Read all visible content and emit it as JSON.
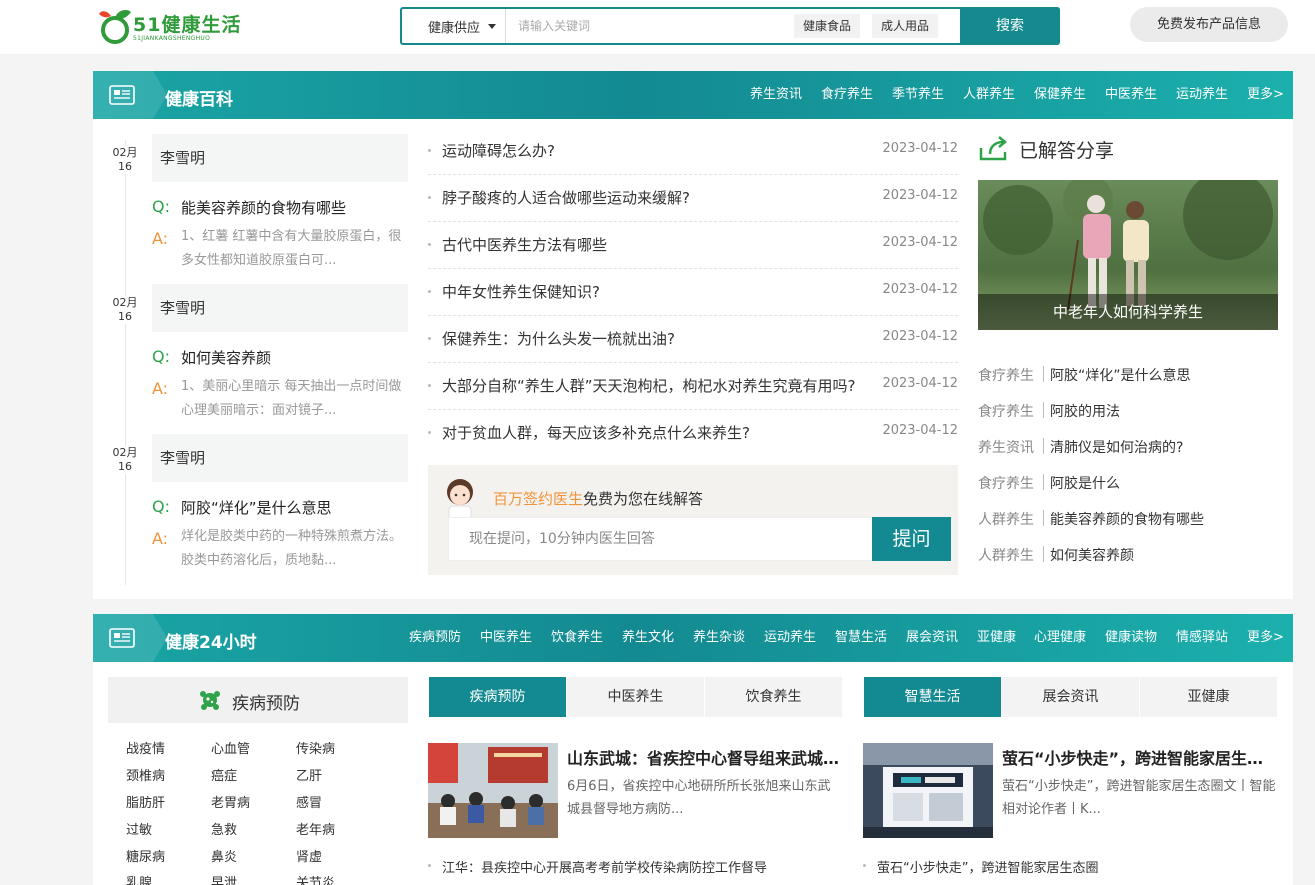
{
  "header": {
    "logo_text": "51健康生活",
    "logo_sub": "51JIANKANGSHENGHUO",
    "search_category": "健康供应",
    "search_placeholder": "请输入关键词",
    "hot_tags": [
      "健康食品",
      "成人用品"
    ],
    "search_button": "搜索",
    "publish_button": "免费发布产品信息"
  },
  "section1": {
    "title": "健康百科",
    "nav": [
      "养生资讯",
      "食疗养生",
      "季节养生",
      "人群养生",
      "保健养生",
      "中医养生",
      "运动养生",
      "更多>"
    ],
    "qa": [
      {
        "month": "02月",
        "day": "16",
        "asker": "李雪明",
        "q_mark": "Q:",
        "question": "能美容养颜的食物有哪些",
        "a_mark": "A:",
        "answer": "1、红薯 红薯中含有大量胶原蛋白，很多女性都知道胶原蛋白可..."
      },
      {
        "month": "02月",
        "day": "16",
        "asker": "李雪明",
        "q_mark": "Q:",
        "question": "如何美容养颜",
        "a_mark": "A:",
        "answer": "1、美丽心里暗示 每天抽出一点时间做心理美丽暗示：面对镜子..."
      },
      {
        "month": "02月",
        "day": "16",
        "asker": "李雪明",
        "q_mark": "Q:",
        "question": "阿胶“烊化”是什么意思",
        "a_mark": "A:",
        "answer": "烊化是胶类中药的一种特殊煎煮方法。 胶类中药溶化后，质地黏..."
      }
    ],
    "list": [
      {
        "title": "运动障碍怎么办?",
        "date": "2023-04-12"
      },
      {
        "title": "脖子酸疼的人适合做哪些运动来缓解?",
        "date": "2023-04-12"
      },
      {
        "title": "古代中医养生方法有哪些",
        "date": "2023-04-12"
      },
      {
        "title": "中年女性养生保健知识?",
        "date": "2023-04-12"
      },
      {
        "title": "保健养生：为什么头发一梳就出油?",
        "date": "2023-04-12"
      },
      {
        "title": "大部分自称“养生人群”天天泡枸杞，枸杞水对养生究竟有用吗?",
        "date": "2023-04-12"
      },
      {
        "title": "对于贫血人群，每天应该多补充点什么来养生?",
        "date": "2023-04-12"
      }
    ],
    "ask": {
      "highlight": "百万签约医生",
      "rest": "免费为您在线解答",
      "placeholder": "现在提问，10分钟内医生回答",
      "button": "提问"
    },
    "shared": {
      "title": "已解答分享",
      "photo_caption": "中老年人如何科学养生",
      "items": [
        {
          "cat": "食疗养生",
          "title": "阿胶“烊化”是什么意思"
        },
        {
          "cat": "食疗养生",
          "title": "阿胶的用法"
        },
        {
          "cat": "养生资讯",
          "title": "清肺仪是如何治病的?"
        },
        {
          "cat": "食疗养生",
          "title": "阿胶是什么"
        },
        {
          "cat": "人群养生",
          "title": "能美容养颜的食物有哪些"
        },
        {
          "cat": "人群养生",
          "title": "如何美容养颜"
        }
      ]
    }
  },
  "section2": {
    "title": "健康24小时",
    "nav": [
      "疾病预防",
      "中医养生",
      "饮食养生",
      "养生文化",
      "养生杂谈",
      "运动养生",
      "智慧生活",
      "展会资讯",
      "亚健康",
      "心理健康",
      "健康读物",
      "情感驿站",
      "更多>"
    ],
    "category_title": "疾病预防",
    "categories": [
      [
        "战疫情",
        "心血管",
        "传染病"
      ],
      [
        "颈椎病",
        "癌症",
        "乙肝"
      ],
      [
        "脂肪肝",
        "老胃病",
        "感冒"
      ],
      [
        "过敏",
        "急救",
        "老年病"
      ],
      [
        "糖尿病",
        "鼻炎",
        "肾虚"
      ],
      [
        "乳腺",
        "早泄",
        "关节炎"
      ]
    ],
    "tabs_left": [
      "疾病预防",
      "中医养生",
      "饮食养生"
    ],
    "tabs_right": [
      "智慧生活",
      "展会资讯",
      "亚健康"
    ],
    "news_left": {
      "title": "山东武城：省疾控中心督导组来武城县督导",
      "desc": "6月6日，省疾控中心地研所所长张旭来山东武城县督导地方病防...",
      "line": "江华：县疾控中心开展高考考前学校传染病防控工作督导"
    },
    "news_right": {
      "title": "萤石“小步快走”，跨进智能家居生态圈文",
      "desc": "萤石“小步快走”，跨进智能家居生态圈文丨智能相对论作者丨K...",
      "line": "萤石“小步快走”，跨进智能家居生态圈"
    }
  },
  "colors": {
    "teal": "#138a91",
    "green": "#2fa34a",
    "orange": "#f2933a"
  }
}
